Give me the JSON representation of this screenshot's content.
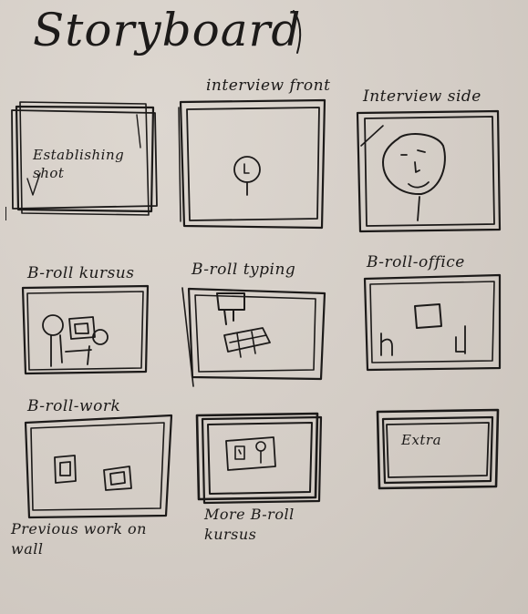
{
  "page_title": "Storyboard",
  "frames": [
    {
      "label": "",
      "inner_text": "Establishing shot",
      "caption": ""
    },
    {
      "label": "interview front",
      "inner_text": "",
      "caption": ""
    },
    {
      "label": "Interview side",
      "inner_text": "",
      "caption": ""
    },
    {
      "label": "B-roll kursus",
      "inner_text": "",
      "caption": ""
    },
    {
      "label": "B-roll typing",
      "inner_text": "",
      "caption": ""
    },
    {
      "label": "B-roll-office",
      "inner_text": "",
      "caption": ""
    },
    {
      "label": "B-roll-work",
      "inner_text": "",
      "caption": "Previous work on wall"
    },
    {
      "label": "",
      "inner_text": "",
      "caption": "More B-roll kursus"
    },
    {
      "label": "",
      "inner_text": "Extra",
      "caption": ""
    }
  ],
  "colors": {
    "paper": "#d4cdc6",
    "ink": "#1c1a19"
  }
}
